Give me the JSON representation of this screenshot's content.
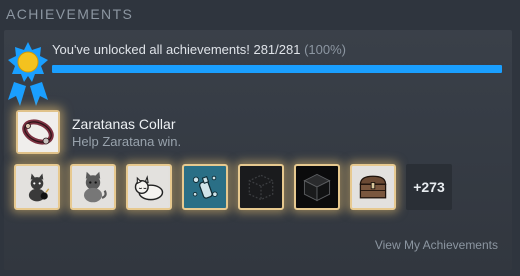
{
  "section": {
    "title": "ACHIEVEMENTS"
  },
  "summary": {
    "text": "You've unlocked all achievements! 281/281",
    "percent_label": "(100%)",
    "progress": 1.0,
    "bar_color": "#1a9fff"
  },
  "featured": {
    "icon": "collar-icon",
    "title": "Zaratanas Collar",
    "description": "Help Zaratana win."
  },
  "achievements": [
    {
      "icon": "cat-with-bomb-icon",
      "theme": "light"
    },
    {
      "icon": "cat-sitting-icon",
      "theme": "light"
    },
    {
      "icon": "cat-sleeping-icon",
      "theme": "light"
    },
    {
      "icon": "potion-bottle-icon",
      "theme": "teal"
    },
    {
      "icon": "outlined-cube-icon",
      "theme": "dark"
    },
    {
      "icon": "solid-cube-icon",
      "theme": "dark2"
    },
    {
      "icon": "treasure-chest-icon",
      "theme": "light"
    }
  ],
  "more_count": "+273",
  "view_link": "View My Achievements",
  "accent_gold": "#e7c98f"
}
